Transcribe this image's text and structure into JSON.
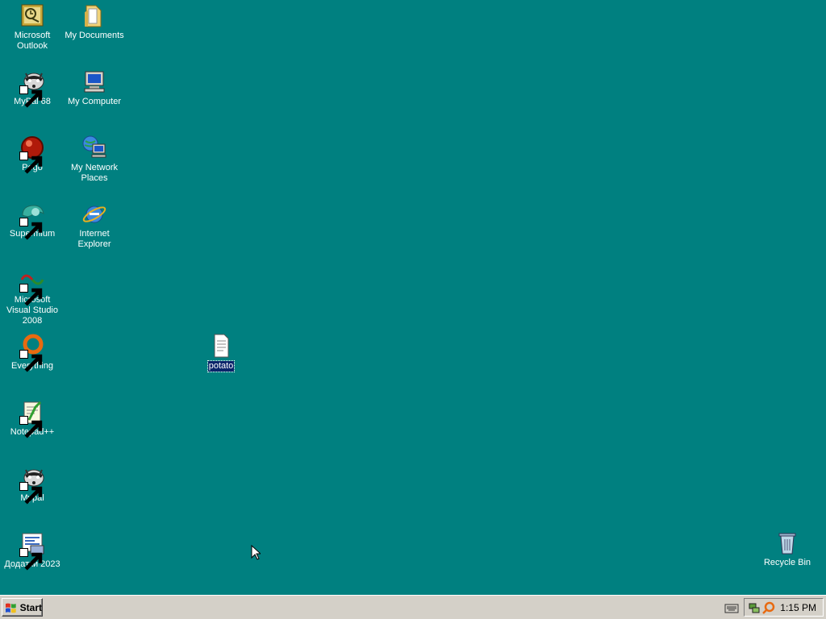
{
  "desktop": {
    "background": "#008080",
    "icons": [
      {
        "label": "Microsoft Outlook",
        "icon": "outlook-icon",
        "shortcut": false
      },
      {
        "label": "My Documents",
        "icon": "folder-icon",
        "shortcut": false
      },
      {
        "label": "MyPal 68",
        "icon": "raccoon-icon",
        "shortcut": true
      },
      {
        "label": "My Computer",
        "icon": "computer-icon",
        "shortcut": false
      },
      {
        "label": "Pego",
        "icon": "pego-icon",
        "shortcut": true
      },
      {
        "label": "My Network Places",
        "icon": "network-icon",
        "shortcut": false
      },
      {
        "label": "Supermium",
        "icon": "supermium-icon",
        "shortcut": true
      },
      {
        "label": "Internet Explorer",
        "icon": "ie-icon",
        "shortcut": false
      },
      {
        "label": "Microsoft Visual Studio 2008",
        "icon": "visual-studio-icon",
        "shortcut": true
      },
      {
        "label": "Everything",
        "icon": "everything-search-icon",
        "shortcut": true
      },
      {
        "label": "Notepad++",
        "icon": "notepad-plus-plus-icon",
        "shortcut": true
      },
      {
        "label": "Mypal",
        "icon": "raccoon-icon",
        "shortcut": true
      },
      {
        "label": "Додатки 2023",
        "icon": "document-printer-icon",
        "shortcut": true
      },
      {
        "label": "potato",
        "icon": "text-file-icon",
        "shortcut": false,
        "selected": true
      },
      {
        "label": "Recycle Bin",
        "icon": "recycle-bin-icon",
        "shortcut": false
      }
    ]
  },
  "taskbar": {
    "start_label": "Start",
    "tray": {
      "keyboard_icon": "keyboard-icon",
      "icons": [
        "network-tray-icon",
        "search-tray-icon"
      ],
      "clock": "1:15 PM"
    }
  }
}
